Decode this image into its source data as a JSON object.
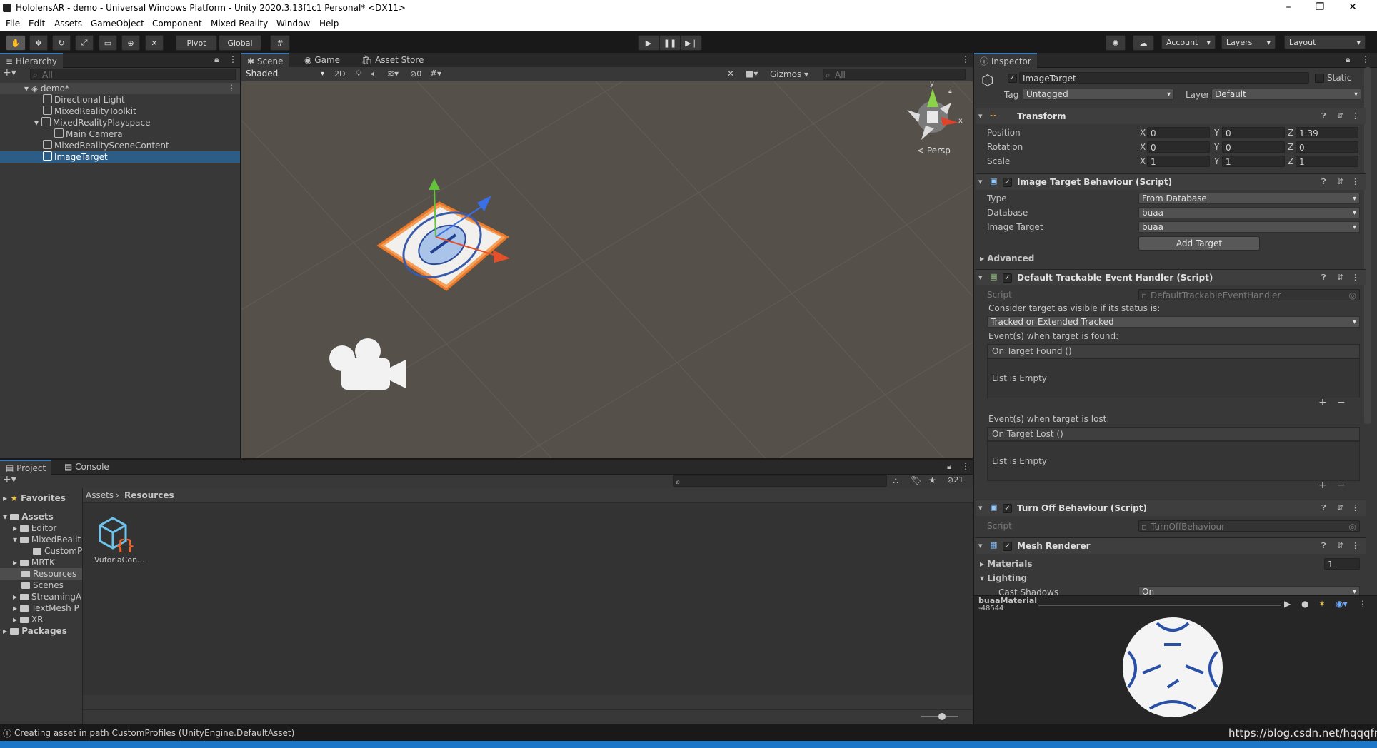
{
  "window": {
    "title": "HololensAR - demo - Universal Windows Platform - Unity 2020.3.13f1c1 Personal* <DX11>"
  },
  "menu": [
    "File",
    "Edit",
    "Assets",
    "GameObject",
    "Component",
    "Mixed Reality",
    "Window",
    "Help"
  ],
  "toolbar": {
    "pivot": "Pivot",
    "global": "Global",
    "account": "Account",
    "layers": "Layers",
    "layout": "Layout"
  },
  "hierarchy": {
    "tab": "Hierarchy",
    "search_placeholder": "All",
    "items": [
      {
        "label": "demo*"
      },
      {
        "label": "Directional Light"
      },
      {
        "label": "MixedRealityToolkit"
      },
      {
        "label": "MixedRealityPlayspace"
      },
      {
        "label": "Main Camera"
      },
      {
        "label": "MixedRealitySceneContent"
      },
      {
        "label": "ImageTarget"
      }
    ]
  },
  "scene": {
    "tabs": [
      "Scene",
      "Game",
      "Asset Store"
    ],
    "shading": "Shaded",
    "mode2d": "2D",
    "hidden_count": "0",
    "gizmos": "Gizmos",
    "search_placeholder": "All",
    "persp": "Persp",
    "gizmo_y": "y",
    "gizmo_x": "x"
  },
  "inspector": {
    "tab": "Inspector",
    "object_name": "ImageTarget",
    "static_label": "Static",
    "tag_label": "Tag",
    "tag_value": "Untagged",
    "layer_label": "Layer",
    "layer_value": "Default",
    "transform": {
      "title": "Transform",
      "position_label": "Position",
      "position": [
        "0",
        "0",
        "1.39"
      ],
      "rotation_label": "Rotation",
      "rotation": [
        "0",
        "0",
        "0"
      ],
      "scale_label": "Scale",
      "scale": [
        "1",
        "1",
        "1"
      ],
      "axes": [
        "X",
        "Y",
        "Z"
      ]
    },
    "image_target": {
      "title": "Image Target Behaviour (Script)",
      "type_label": "Type",
      "type_value": "From Database",
      "database_label": "Database",
      "database_value": "buaa",
      "image_label": "Image Target",
      "image_value": "buaa",
      "add_button": "Add Target",
      "advanced": "Advanced"
    },
    "event_handler": {
      "title": "Default Trackable Event Handler (Script)",
      "script_label": "Script",
      "script_value": "DefaultTrackableEventHandler",
      "consider_label": "Consider target as visible if its status is:",
      "status_value": "Tracked or Extended Tracked",
      "found_label": "Event(s) when target is found:",
      "found_event": "On Target Found ()",
      "found_empty": "List is Empty",
      "lost_label": "Event(s) when target is lost:",
      "lost_event": "On Target Lost ()",
      "lost_empty": "List is Empty"
    },
    "turn_off": {
      "title": "Turn Off Behaviour (Script)",
      "script_label": "Script",
      "script_value": "TurnOffBehaviour"
    },
    "mesh_renderer": {
      "title": "Mesh Renderer",
      "materials_label": "Materials",
      "materials_count": "1",
      "lighting_label": "Lighting",
      "cast_shadows_label": "Cast Shadows",
      "cast_shadows_value": "On"
    },
    "preview_label": "buaaMaterial",
    "preview_sub": "-48544"
  },
  "project": {
    "tabs": [
      "Project",
      "Console"
    ],
    "favorites": "Favorites",
    "assets": "Assets",
    "folders": [
      "Editor",
      "MixedRealit",
      "CustomP",
      "MRTK",
      "Resources",
      "Scenes",
      "StreamingA",
      "TextMesh P",
      "XR"
    ],
    "packages": "Packages",
    "breadcrumb": [
      "Assets",
      "Resources"
    ],
    "hidden_count": "21",
    "asset_item": "VuforiaCon..."
  },
  "status": {
    "message": "Creating asset in path CustomProfiles (UnityEngine.DefaultAsset)",
    "watermark": "https://blog.csdn.net/hqqqfn"
  }
}
